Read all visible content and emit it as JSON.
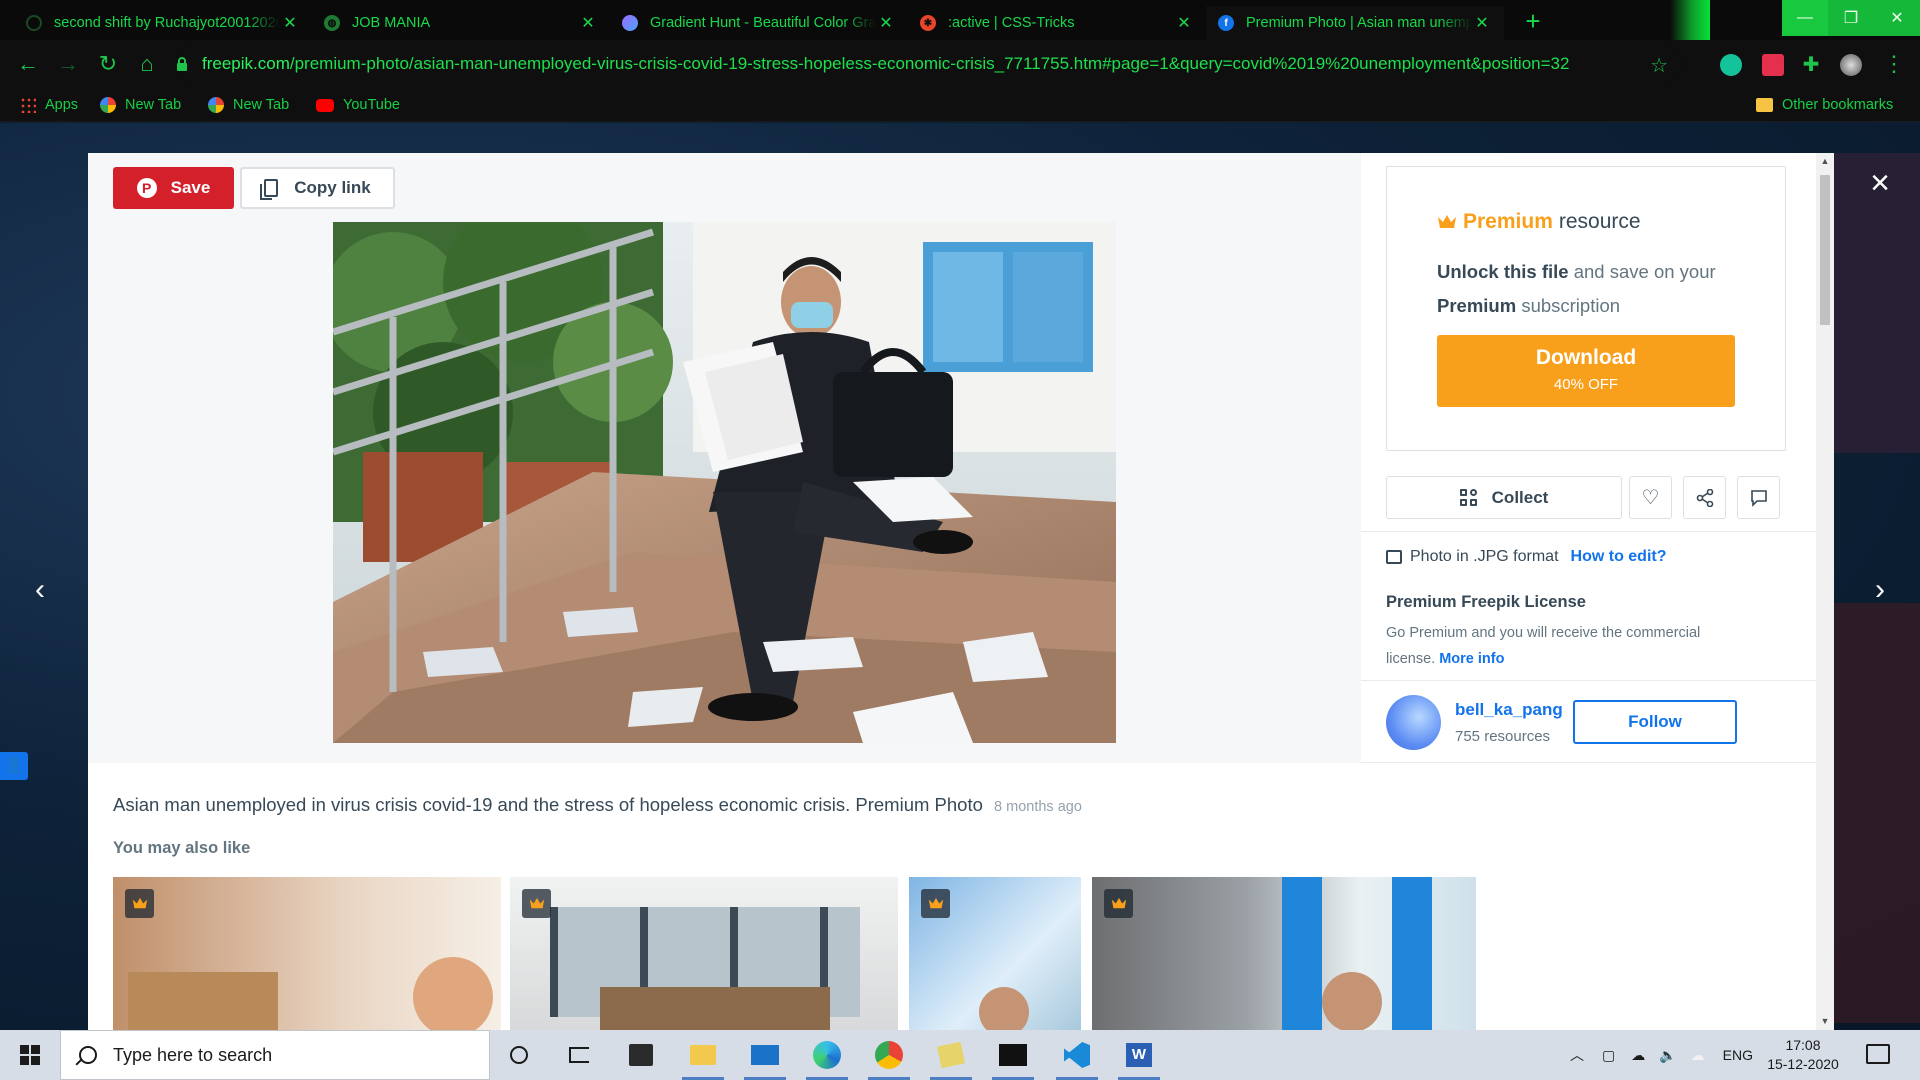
{
  "browser": {
    "tabs": [
      {
        "title": "second shift by Ruchajyot20012020",
        "active": false
      },
      {
        "title": "JOB MANIA",
        "active": false
      },
      {
        "title": "Gradient Hunt - Beautiful Color Gradients",
        "active": false
      },
      {
        "title": ":active | CSS-Tricks",
        "active": false
      },
      {
        "title": "Premium Photo | Asian man unemployed",
        "active": true
      }
    ],
    "new_tab_label": "+",
    "url_host": "freepik.com",
    "url_path": "/premium-photo/asian-man-unemployed-virus-crisis-covid-19-stress-hopeless-economic-crisis_7711755.htm#page=1&query=covid%2019%20unemployment&position=32",
    "bookmarks": [
      "Apps",
      "New Tab",
      "New Tab",
      "YouTube"
    ],
    "other_bookmarks": "Other bookmarks",
    "accent_color": "#18d94a"
  },
  "modal": {
    "save_label": "Save",
    "copy_link_label": "Copy link",
    "premium": {
      "title_bold": "Premium",
      "title_rest": "resource",
      "desc_bold1": "Unlock this file",
      "desc_mid": "and save on your",
      "desc_bold2": "Premium",
      "desc_end": "subscription",
      "download_label": "Download",
      "download_sub": "40% OFF"
    },
    "collect_label": "Collect",
    "format_label": "Photo in .JPG format",
    "how_to_edit": "How to edit?",
    "license_title": "Premium Freepik License",
    "license_text": "Go Premium and you will receive the commercial license.",
    "more_info": "More info",
    "author": {
      "name": "bell_ka_pang",
      "resources": "755 resources",
      "follow_label": "Follow"
    },
    "caption": "Asian man unemployed in virus crisis covid-19 and the stress of hopeless economic crisis. Premium Photo",
    "caption_age": "8 months ago",
    "also_like": "You may also like",
    "colors": {
      "save": "#d4202a",
      "premium": "#f8a01b",
      "link": "#1273eb",
      "text": "#374957"
    }
  },
  "taskbar": {
    "search_placeholder": "Type here to search",
    "language": "ENG",
    "time": "17:08",
    "date": "15-12-2020"
  }
}
